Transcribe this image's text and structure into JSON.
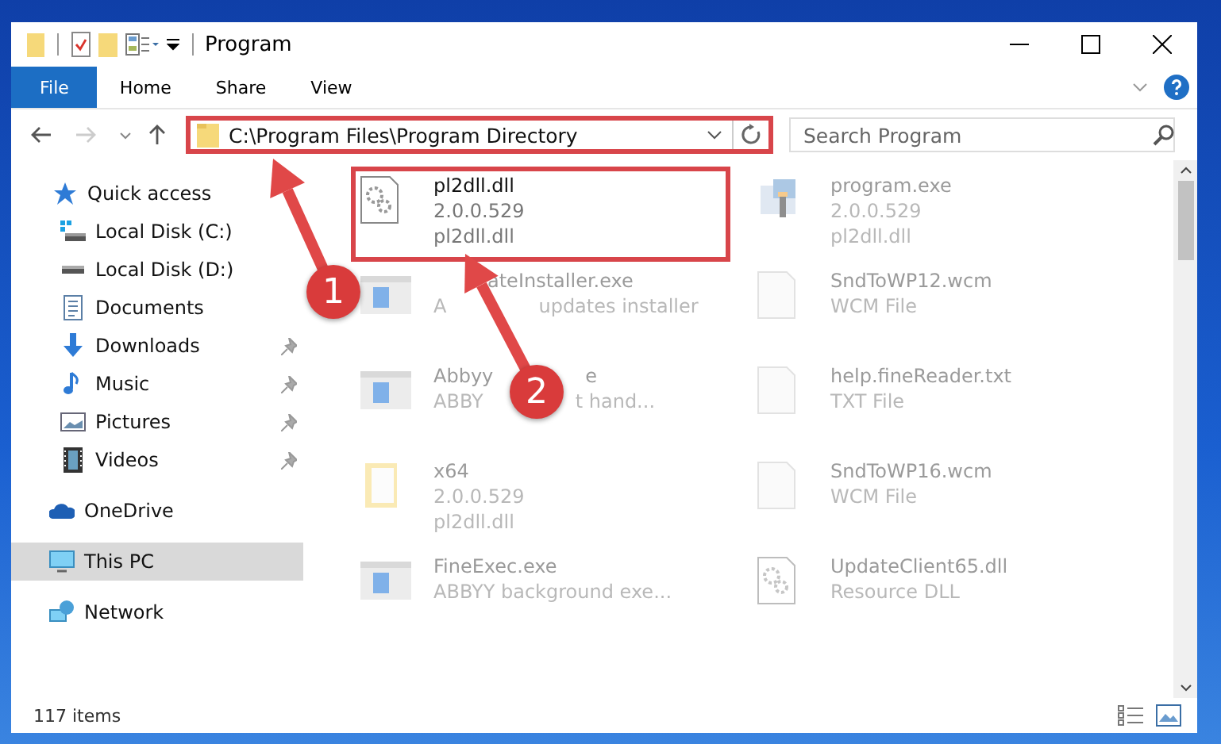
{
  "window": {
    "title": "Program"
  },
  "ribbon_tabs": [
    {
      "label": "File",
      "selected": true
    },
    {
      "label": "Home",
      "selected": false
    },
    {
      "label": "Share",
      "selected": false
    },
    {
      "label": "View",
      "selected": false
    }
  ],
  "address": {
    "path": "C:\\Program Files\\Program Directory",
    "highlighted": true
  },
  "search": {
    "placeholder": "Search Program"
  },
  "sidebar": {
    "items": [
      {
        "label": "Quick access",
        "kind": "quick",
        "pinned": false,
        "selected": false
      },
      {
        "label": "Local Disk (C:)",
        "kind": "sysdrive",
        "pinned": false,
        "selected": false
      },
      {
        "label": "Local Disk (D:)",
        "kind": "drive",
        "pinned": false,
        "selected": false
      },
      {
        "label": "Documents",
        "kind": "documents",
        "pinned": false,
        "selected": false
      },
      {
        "label": "Downloads",
        "kind": "downloads",
        "pinned": true,
        "selected": false
      },
      {
        "label": "Music",
        "kind": "music",
        "pinned": true,
        "selected": false
      },
      {
        "label": "Pictures",
        "kind": "pictures",
        "pinned": true,
        "selected": false
      },
      {
        "label": "Videos",
        "kind": "videos",
        "pinned": true,
        "selected": false
      },
      {
        "label": "OneDrive",
        "kind": "onedrive",
        "pinned": false,
        "selected": false
      },
      {
        "label": "This PC",
        "kind": "pc",
        "pinned": false,
        "selected": true
      },
      {
        "label": "Network",
        "kind": "network",
        "pinned": false,
        "selected": false
      }
    ]
  },
  "files": [
    {
      "name": [
        "pl2dll.dll"
      ],
      "details": [
        [
          "2.0.0.529"
        ],
        [
          "pl2dll.dll"
        ]
      ],
      "kind": "dll",
      "highlighted": true,
      "faded": false,
      "covered": false
    },
    {
      "name": [
        "program.exe"
      ],
      "details": [
        [
          "2.0.0.529"
        ],
        [
          "pl2dll.dll"
        ]
      ],
      "kind": "setup",
      "highlighted": false,
      "faded": true,
      "covered": false
    },
    {
      "name": [
        "ateInstaller.exe"
      ],
      "details": [
        [
          "A",
          "updates installer"
        ]
      ],
      "kind": "exe",
      "highlighted": false,
      "faded": true,
      "covered": true
    },
    {
      "name": [
        "SndToWP12.wcm"
      ],
      "details": [
        [
          "WCM File"
        ]
      ],
      "kind": "file",
      "highlighted": false,
      "faded": true,
      "covered": false
    },
    {
      "name": [
        "Abbyy",
        "e"
      ],
      "details": [
        [
          "ABBY",
          "t hand..."
        ]
      ],
      "kind": "exe",
      "highlighted": false,
      "faded": true,
      "covered": false
    },
    {
      "name": [
        "help.fineReader.txt"
      ],
      "details": [
        [
          "TXT File"
        ]
      ],
      "kind": "file",
      "highlighted": false,
      "faded": true,
      "covered": false
    },
    {
      "name": [
        "x64"
      ],
      "details": [
        [
          "2.0.0.529"
        ],
        [
          "pl2dll.dll"
        ]
      ],
      "kind": "folder",
      "highlighted": false,
      "faded": true,
      "covered": false
    },
    {
      "name": [
        "SndToWP16.wcm"
      ],
      "details": [
        [
          "WCM File"
        ]
      ],
      "kind": "file",
      "highlighted": false,
      "faded": true,
      "covered": false
    },
    {
      "name": [
        "FineExec.exe"
      ],
      "details": [
        [
          "ABBYY background exe..."
        ]
      ],
      "kind": "exe",
      "highlighted": false,
      "faded": true,
      "covered": false
    },
    {
      "name": [
        "UpdateClient65.dll"
      ],
      "details": [
        [
          "Resource DLL"
        ]
      ],
      "kind": "dll",
      "highlighted": false,
      "faded": true,
      "covered": false
    }
  ],
  "annotations": [
    {
      "label": "1"
    },
    {
      "label": "2"
    }
  ],
  "status_bar": {
    "count": "117 items"
  }
}
